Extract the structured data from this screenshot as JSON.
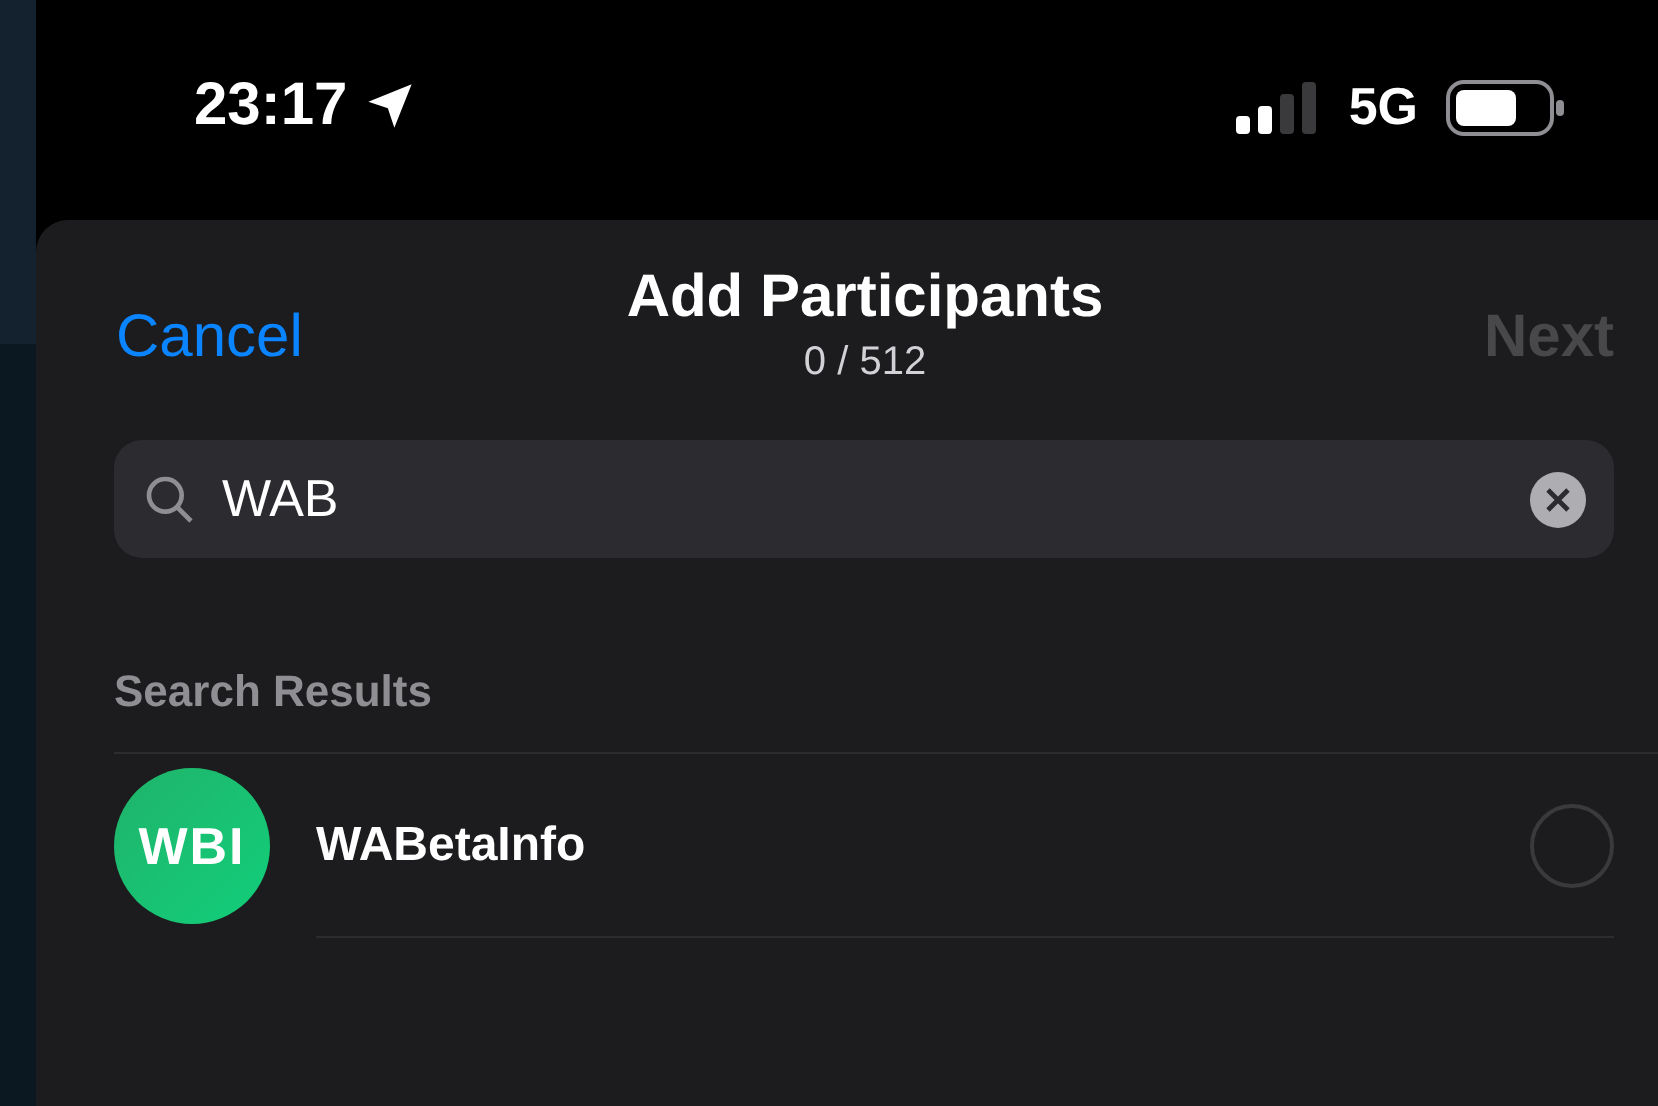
{
  "status_bar": {
    "time": "23:17",
    "network": "5G"
  },
  "header": {
    "cancel": "Cancel",
    "title": "Add Participants",
    "count": "0 / 512",
    "next": {
      "label": "Next",
      "disabled": true
    }
  },
  "search": {
    "value": "WAB"
  },
  "section_title": "Search Results",
  "results": [
    {
      "name": "WABetaInfo",
      "avatar_text": "WBI",
      "selected": false
    }
  ]
}
